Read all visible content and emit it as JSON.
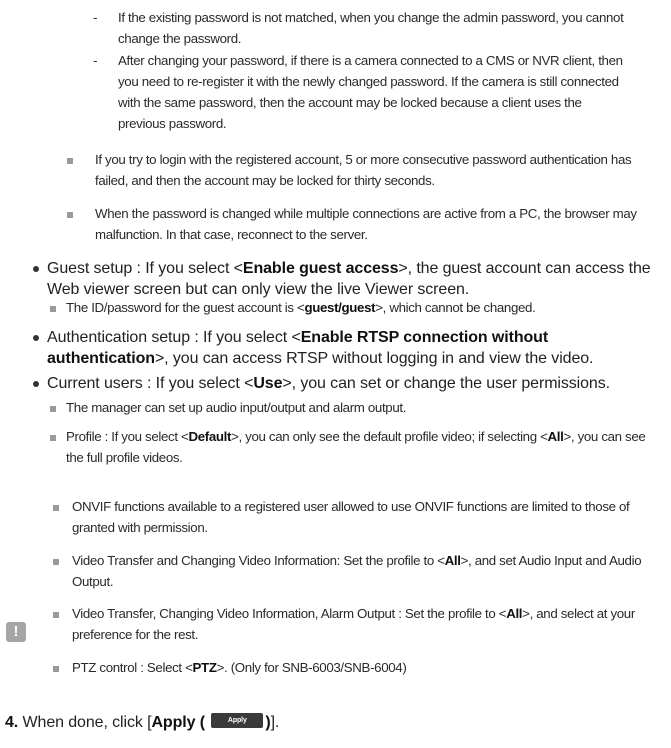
{
  "dash_items": [
    "If the existing password is not matched, when you change the admin password, you cannot change the password.",
    "After changing your password, if there is a camera connected to a CMS or NVR client, then you need to re-register it with the newly changed password. If the camera is still connected with the same password, then the account may be locked because a client uses the previous password."
  ],
  "top_notes": [
    "If you try to login with the registered account, 5 or more consecutive password authentication has failed, and then the account may be locked for thirty seconds.",
    "When the password is changed while multiple connections are active from a PC, the browser may malfunction. In that case, reconnect to the server."
  ],
  "guest": {
    "prefix": "Guest setup : If you select <",
    "bold": "Enable guest access",
    "suffix": ">, the guest account can access the Web viewer screen but can only view the live Viewer screen.",
    "note_prefix": "The ID/password for the guest account is <",
    "note_bold": "guest/guest",
    "note_suffix": ">, which cannot be changed."
  },
  "auth": {
    "prefix": "Authentication setup : If you select <",
    "bold": "Enable RTSP connection without authentication",
    "suffix": ">, you can access RTSP without logging in and view the video."
  },
  "current_users": {
    "prefix": "Current users : If you select <",
    "bold": "Use",
    "suffix": ">, you can set or change the user permissions.",
    "note1": "The manager can set up audio input/output and alarm output.",
    "note2_a": "Profile : If you select <",
    "note2_b": "Default",
    "note2_c": ">, you can only see the default profile video; if selecting <",
    "note2_d": "All",
    "note2_e": ">, you can see the full profile videos."
  },
  "warning": {
    "icon": "exclamation-icon",
    "item1": "ONVIF functions available to a registered user allowed to use ONVIF functions are limited to those of granted with permission.",
    "item2_a": "Video Transfer and Changing Video Information: Set the profile to <",
    "item2_b": "All",
    "item2_c": ">, and set Audio Input and Audio Output.",
    "item3_a": "Video Transfer, Changing Video Information, Alarm Output : Set the profile to <",
    "item3_b": "All",
    "item3_c": ">, and select at your preference for the rest.",
    "item4_a": "PTZ control : Select <",
    "item4_b": "PTZ",
    "item4_c": ">. (Only for SNB-6003/SNB-6004)"
  },
  "step": {
    "number": "4.",
    "text": "When done, click [",
    "bold": "Apply (",
    "button": "Apply",
    "bold_end": ")",
    "end": "]."
  }
}
